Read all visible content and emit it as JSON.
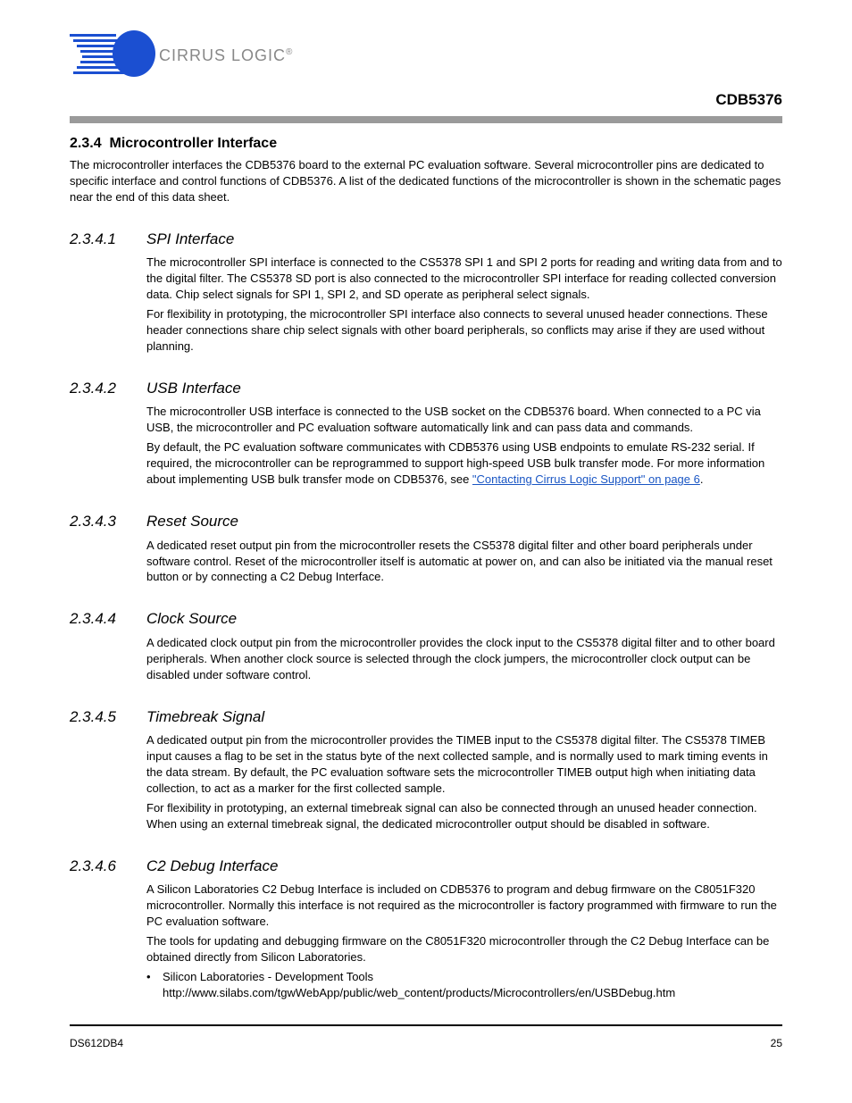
{
  "header": {
    "logo_text": "CIRRUS LOGIC",
    "logo_reg": "®",
    "doc_id": "CDB5376"
  },
  "section_234": {
    "num": "2.3.4",
    "title": "Microcontroller Interface",
    "intro": "The microcontroller interfaces the CDB5376 board to the external PC evaluation software. Several microcontroller pins are dedicated to specific interface and control functions of CDB5376. A list of the dedicated functions of the microcontroller is shown in the schematic pages near the end of this data sheet."
  },
  "s2341": {
    "num": "2.3.4.1",
    "title": "SPI Interface",
    "p1": "The microcontroller SPI interface is connected to the CS5378 SPI 1 and SPI 2 ports for reading and writing data from and to the digital filter. The CS5378 SD port is also connected to the microcontroller SPI interface for reading collected conversion data. Chip select signals for SPI 1, SPI 2, and SD operate as peripheral select signals.",
    "p2": "For flexibility in prototyping, the microcontroller SPI interface also connects to several unused header connections. These header connections share chip select signals with other board peripherals, so conflicts may arise if they are used without planning."
  },
  "s2342": {
    "num": "2.3.4.2",
    "title": "USB Interface",
    "p1": "The microcontroller USB interface is connected to the USB socket on the CDB5376 board. When connected to a PC via USB, the microcontroller and PC evaluation software automatically link and can pass data and commands.",
    "p2_pre": "By default, the PC evaluation software communicates with CDB5376 using USB endpoints to emulate RS-232 serial. If required, the microcontroller can be reprogrammed to support high-speed USB bulk transfer mode. For more information about implementing USB bulk transfer mode on CDB5376, see ",
    "p2_link": "\"Contacting Cirrus Logic Support\" on page 6",
    "p2_post": "."
  },
  "s2343": {
    "num": "2.3.4.3",
    "title": "Reset Source",
    "p1": "A dedicated reset output pin from the microcontroller resets the CS5378 digital filter and other board peripherals under software control. Reset of the microcontroller itself is automatic at power on, and can also be initiated via the manual reset button or by connecting a C2 Debug Interface."
  },
  "s2344": {
    "num": "2.3.4.4",
    "title": "Clock Source",
    "p1": "A dedicated clock output pin from the microcontroller provides the clock input to the CS5378 digital filter and to other board peripherals. When another clock source is selected through the clock jumpers, the microcontroller clock output can be disabled under software control."
  },
  "s2345": {
    "num": "2.3.4.5",
    "title": "Timebreak Signal",
    "p1": "A dedicated output pin from the microcontroller provides the TIMEB input to the CS5378 digital filter. The CS5378 TIMEB input causes a flag to be set in the status byte of the next collected sample, and is normally used to mark timing events in the data stream. By default, the PC evaluation software sets the microcontroller TIMEB output high when initiating data collection, to act as a marker for the first collected sample.",
    "p2": "For flexibility in prototyping, an external timebreak signal can also be connected through an unused header connection. When using an external timebreak signal, the dedicated microcontroller output should be disabled in software."
  },
  "s2346": {
    "num": "2.3.4.6",
    "title": "C2 Debug Interface",
    "p1": "A Silicon Laboratories C2 Debug Interface is included on CDB5376 to program and debug firmware on the C8051F320 microcontroller. Normally this interface is not required as the microcontroller is factory programmed with firmware to run the PC evaluation software.",
    "p2": "The tools for updating and debugging firmware on the C8051F320 microcontroller through the C2 Debug Interface can be obtained directly from Silicon Laboratories.",
    "bullet_label": "Silicon Laboratories - Development Tools",
    "bullet_url": "http://www.silabs.com/tgwWebApp/public/web_content/products/Microcontrollers/en/USBDebug.htm"
  },
  "footer": {
    "ds": "DS612DB4",
    "page": "25"
  }
}
